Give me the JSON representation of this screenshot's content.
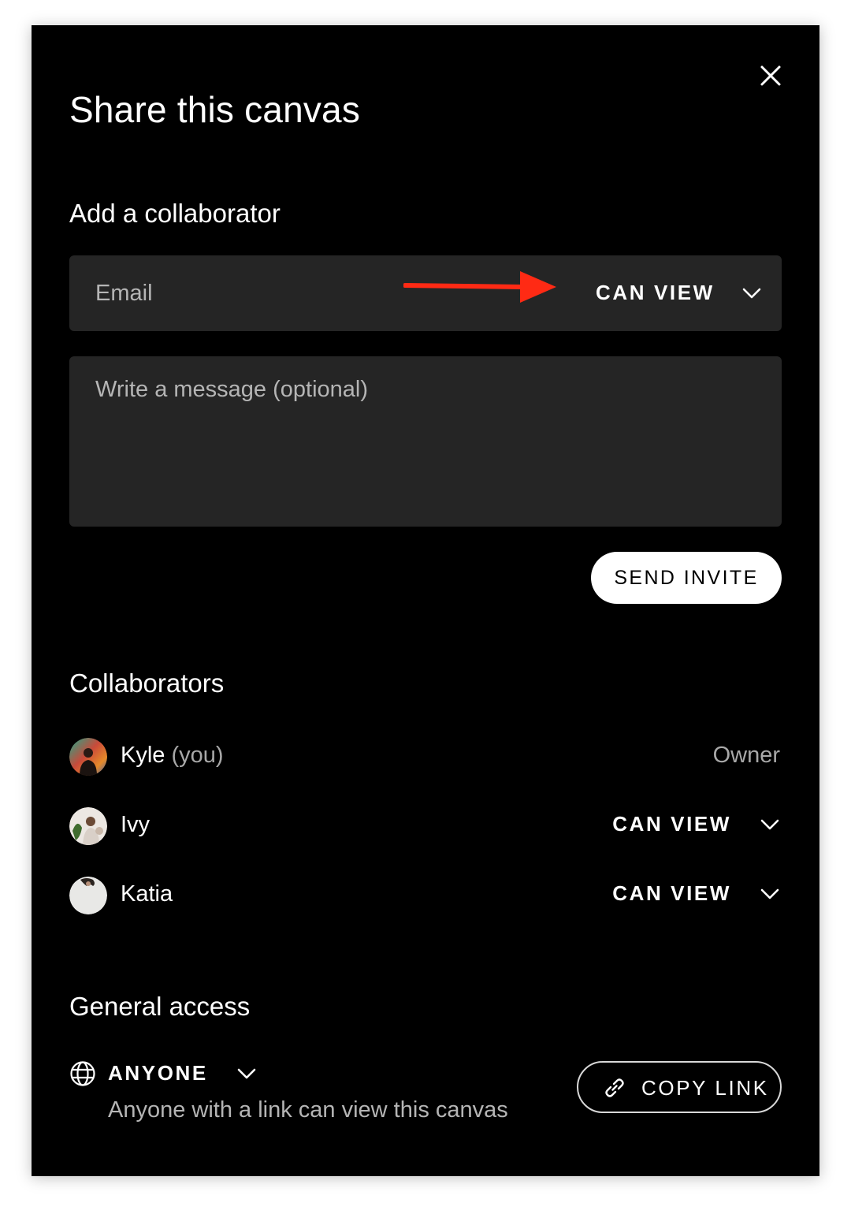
{
  "dialog": {
    "title": "Share this canvas",
    "close_icon": "close-icon"
  },
  "add_collaborator": {
    "heading": "Add a collaborator",
    "email_placeholder": "Email",
    "permission": "CAN VIEW",
    "message_placeholder": "Write a message (optional)",
    "send_label": "SEND INVITE",
    "annotation_color": "#ff2a14"
  },
  "collaborators": {
    "heading": "Collaborators",
    "items": [
      {
        "name": "Kyle",
        "suffix": "(you)",
        "role": "Owner"
      },
      {
        "name": "Ivy",
        "permission": "CAN VIEW"
      },
      {
        "name": "Katia",
        "permission": "CAN VIEW"
      }
    ]
  },
  "general_access": {
    "heading": "General access",
    "icon": "globe-icon",
    "level": "ANYONE",
    "description": "Anyone with a link can view this canvas",
    "copy_icon": "link-icon",
    "copy_label": "COPY LINK"
  }
}
